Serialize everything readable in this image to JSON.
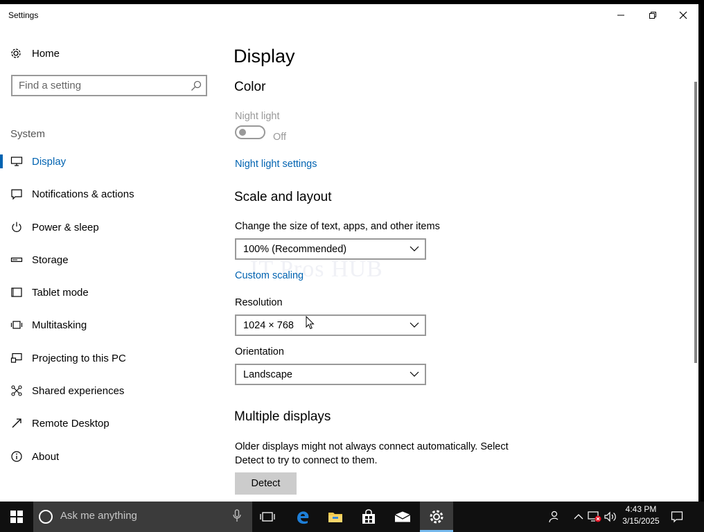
{
  "window": {
    "title": "Settings"
  },
  "nav": {
    "home_label": "Home",
    "search_placeholder": "Find a setting",
    "section_label": "System",
    "items": [
      {
        "label": "Display",
        "icon": "monitor-icon",
        "active": true
      },
      {
        "label": "Notifications & actions",
        "icon": "notification-icon"
      },
      {
        "label": "Power & sleep",
        "icon": "power-icon"
      },
      {
        "label": "Storage",
        "icon": "storage-icon"
      },
      {
        "label": "Tablet mode",
        "icon": "tablet-icon"
      },
      {
        "label": "Multitasking",
        "icon": "multitasking-icon"
      },
      {
        "label": "Projecting to this PC",
        "icon": "projecting-icon"
      },
      {
        "label": "Shared experiences",
        "icon": "shared-experiences-icon"
      },
      {
        "label": "Remote Desktop",
        "icon": "remote-desktop-icon"
      },
      {
        "label": "About",
        "icon": "info-icon"
      }
    ]
  },
  "content": {
    "page_title": "Display",
    "color": {
      "heading": "Color",
      "night_light_label": "Night light",
      "night_light_state": "Off",
      "night_light_settings_link": "Night light settings"
    },
    "scale": {
      "heading": "Scale and layout",
      "size_label": "Change the size of text, apps, and other items",
      "size_value": "100% (Recommended)",
      "custom_scaling_link": "Custom scaling",
      "resolution_label": "Resolution",
      "resolution_value": "1024 × 768",
      "orientation_label": "Orientation",
      "orientation_value": "Landscape"
    },
    "multiple": {
      "heading": "Multiple displays",
      "description": "Older displays might not always connect automatically. Select Detect to try to connect to them.",
      "detect_button": "Detect"
    },
    "watermark": "IT Pros HUB"
  },
  "taskbar": {
    "search_text": "Ask me anything",
    "time": "4:43 PM",
    "date": "3/15/2025"
  },
  "colors": {
    "accent": "#0063b1",
    "taskbar": "#101010",
    "taskbar_search": "#3b3b3b"
  }
}
